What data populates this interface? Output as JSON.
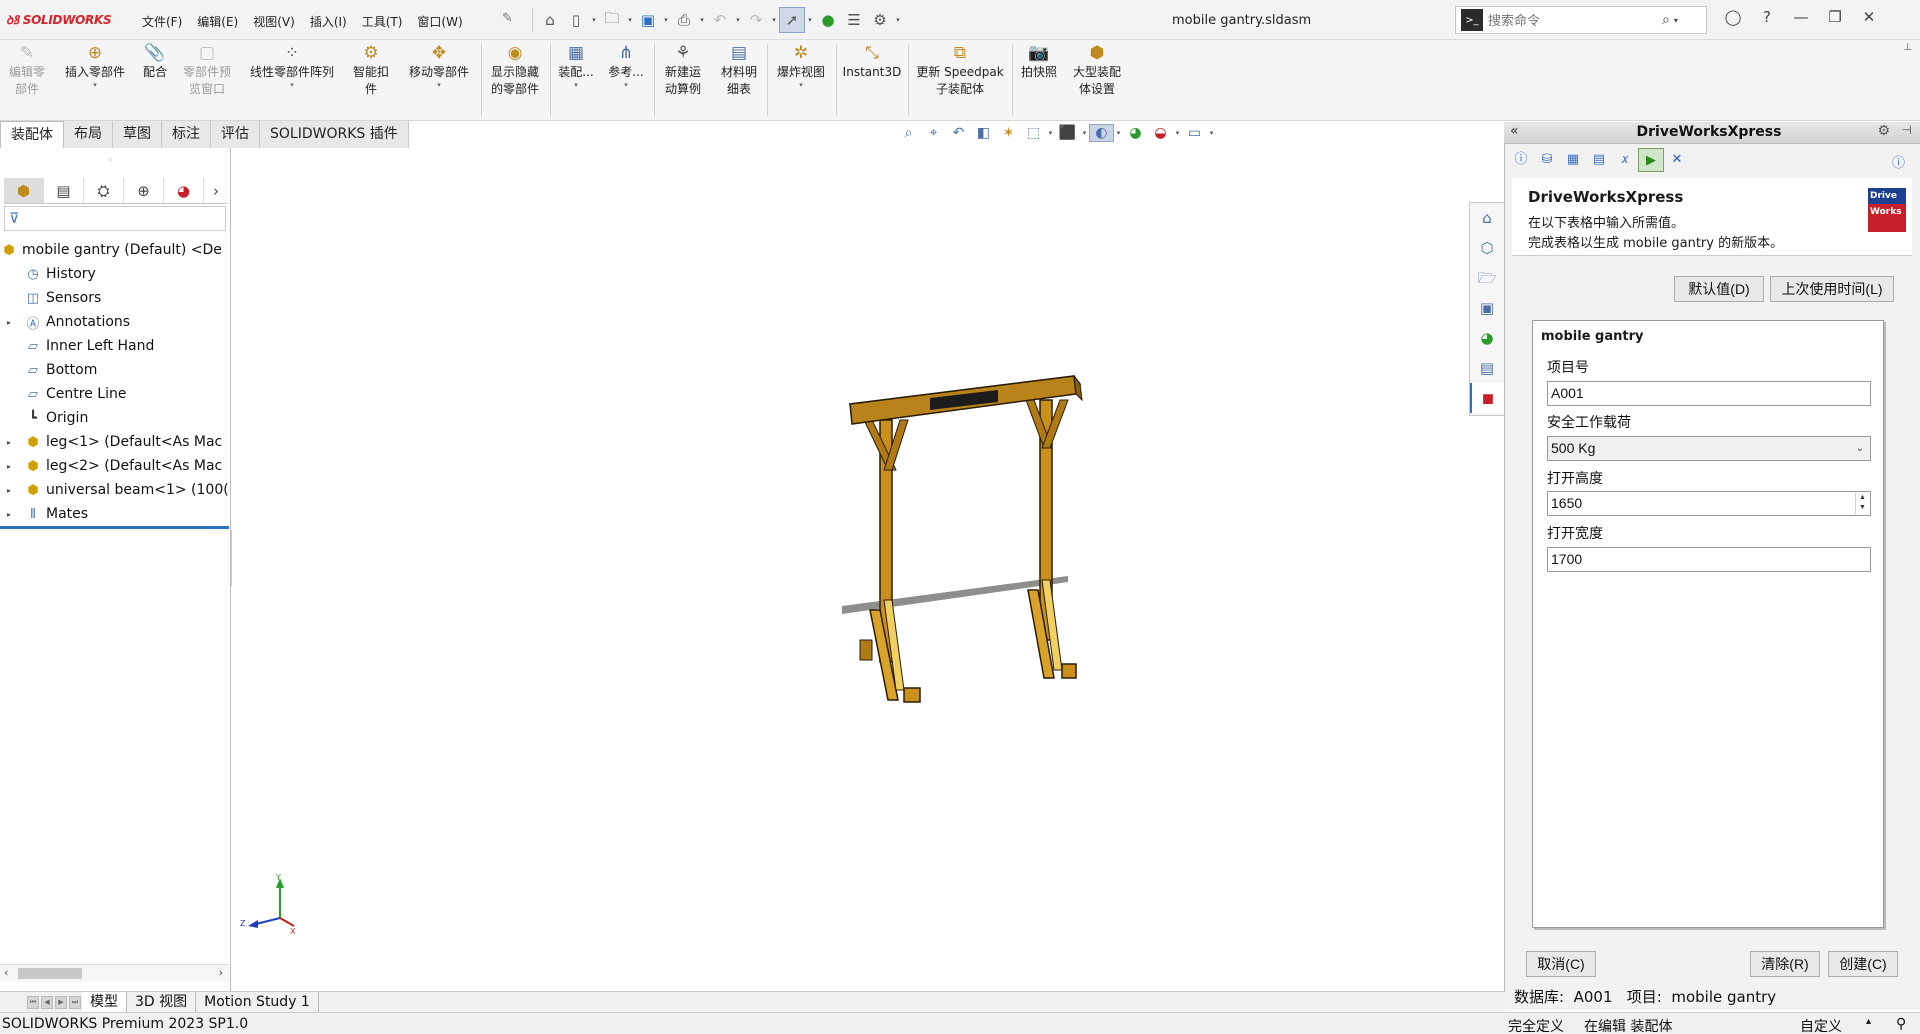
{
  "app": {
    "logo": "SOLIDWORKS",
    "doc_title": "mobile gantry.sldasm"
  },
  "menu": [
    "文件(F)",
    "编辑(E)",
    "视图(V)",
    "插入(I)",
    "工具(T)",
    "窗口(W)"
  ],
  "search": {
    "placeholder": "搜索命令"
  },
  "ribbon": [
    {
      "label": "编辑零\n部件",
      "icon": "edit-component-icon",
      "disabled": true
    },
    {
      "label": "插入零部件",
      "icon": "insert-component-icon"
    },
    {
      "label": "配合",
      "icon": "mate-icon"
    },
    {
      "label": "零部件预\n览窗口",
      "icon": "component-preview-icon",
      "disabled": true
    },
    {
      "label": "线性零部件阵列",
      "icon": "linear-pattern-icon"
    },
    {
      "label": "智能扣\n件",
      "icon": "smart-fasteners-icon"
    },
    {
      "label": "移动零部件",
      "icon": "move-component-icon"
    },
    {
      "label": "显示隐藏\n的零部件",
      "icon": "show-hidden-icon"
    },
    {
      "label": "装配...",
      "icon": "assembly-features-icon"
    },
    {
      "label": "参考...",
      "icon": "reference-geometry-icon"
    },
    {
      "label": "新建运\n动算例",
      "icon": "new-motion-study-icon"
    },
    {
      "label": "材料明\n细表",
      "icon": "bom-icon"
    },
    {
      "label": "爆炸视图",
      "icon": "exploded-view-icon"
    },
    {
      "label": "Instant3D",
      "icon": "instant3d-icon"
    },
    {
      "label": "更新 Speedpak\n子装配体",
      "icon": "speedpak-icon"
    },
    {
      "label": "拍快照",
      "icon": "snapshot-icon"
    },
    {
      "label": "大型装配\n体设置",
      "icon": "large-assembly-icon"
    }
  ],
  "command_tabs": [
    "装配体",
    "布局",
    "草图",
    "标注",
    "评估",
    "SOLIDWORKS 插件"
  ],
  "tree": [
    {
      "label": "mobile gantry (Default) <De",
      "icon": "assembly-icon",
      "expand": false
    },
    {
      "label": "History",
      "icon": "history-icon",
      "expand": false
    },
    {
      "label": "Sensors",
      "icon": "sensors-icon",
      "expand": false
    },
    {
      "label": "Annotations",
      "icon": "annotations-icon",
      "expand": true
    },
    {
      "label": "Inner Left Hand",
      "icon": "plane-icon",
      "expand": false
    },
    {
      "label": "Bottom",
      "icon": "plane-icon",
      "expand": false
    },
    {
      "label": "Centre Line",
      "icon": "plane-icon",
      "expand": false
    },
    {
      "label": "Origin",
      "icon": "origin-icon",
      "expand": false
    },
    {
      "label": "leg<1> (Default<As Mac",
      "icon": "part-icon",
      "expand": true
    },
    {
      "label": "leg<2> (Default<As Mac",
      "icon": "part-icon",
      "expand": true
    },
    {
      "label": "universal beam<1> (100(",
      "icon": "part-icon",
      "expand": true
    },
    {
      "label": "Mates",
      "icon": "mates-icon",
      "expand": true
    }
  ],
  "drivew": {
    "panel_title": "DriveWorksXpress",
    "info_title": "DriveWorksXpress",
    "info_line1": "在以下表格中输入所需值。",
    "info_line2": "完成表格以生成 mobile gantry 的新版本。",
    "logo_top": "Drive",
    "logo_bottom": "Works",
    "btn_default": "默认值(D)",
    "btn_last_used": "上次使用时间(L)",
    "form_title": "mobile gantry",
    "fields": [
      {
        "label": "项目号",
        "value": "A001"
      },
      {
        "label": "安全工作载荷",
        "value": "500 Kg"
      },
      {
        "label": "打开高度",
        "value": "1650"
      },
      {
        "label": "打开宽度",
        "value": "1700"
      }
    ],
    "btn_cancel": "取消(C)",
    "btn_clear": "清除(R)",
    "btn_create": "创建(C)",
    "status": "数据库:  A001   项目:  mobile gantry"
  },
  "bottom_tabs": [
    "模型",
    "3D 视图",
    "Motion Study 1"
  ],
  "statusbar": {
    "version": "SOLIDWORKS Premium 2023 SP1.0",
    "defined": "完全定义",
    "editing": "在编辑 装配体",
    "custom": "自定义"
  },
  "colors": {
    "beam": "#c9901c",
    "accent": "#2f6fc0",
    "brand": "#d8232a"
  },
  "triad": {
    "x": "X",
    "y": "Y",
    "z": "Z"
  }
}
